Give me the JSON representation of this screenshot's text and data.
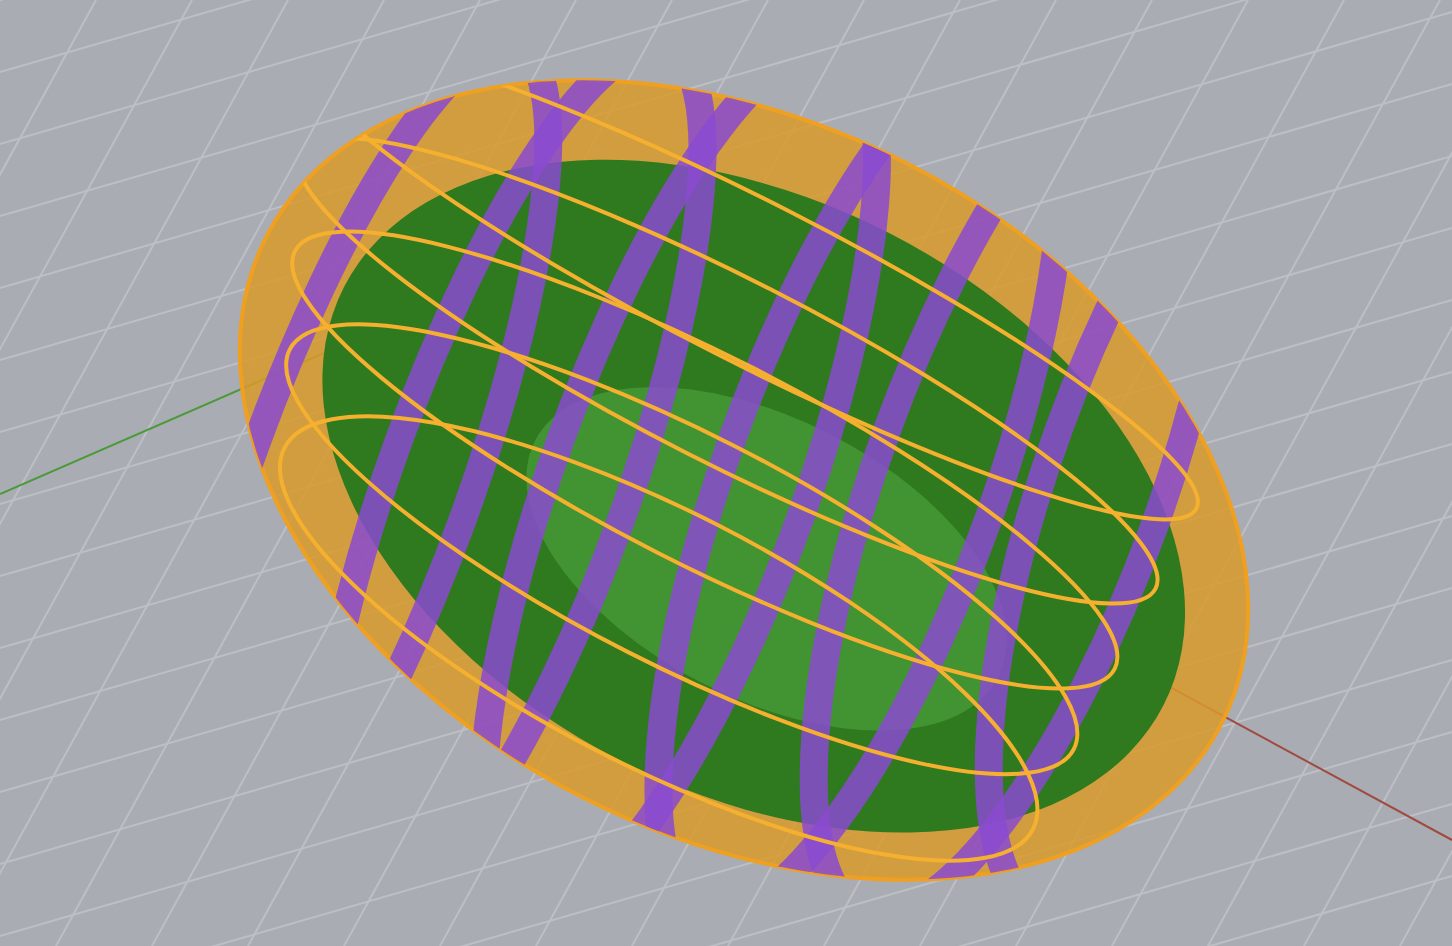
{
  "viewport": {
    "grid": true,
    "axes": true,
    "shaded": true
  }
}
